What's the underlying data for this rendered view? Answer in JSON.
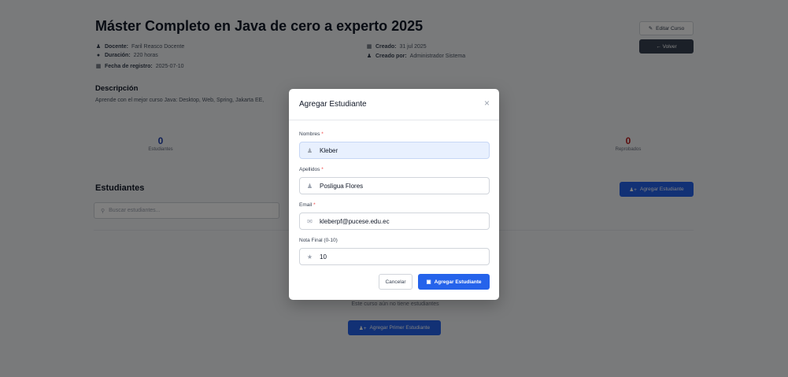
{
  "course": {
    "title": "Máster Completo en Java de cero a experto 2025",
    "docente_label": "Docente:",
    "docente_value": "Faril Reasco Docente",
    "duracion_label": "Duración:",
    "duracion_value": "220 horas",
    "fecha_label": "Fecha de registro:",
    "fecha_value": "2025-07-10",
    "creado_label": "Creado:",
    "creado_value": "31 jul 2025",
    "creado_por_label": "Creado por:",
    "creado_por_value": "Administrador Sistema"
  },
  "actions": {
    "edit_label": "Editar Curso",
    "back_label": "← Volver"
  },
  "description": {
    "heading": "Descripción",
    "text": "Aprende con el mejor curso Java: Desktop, Web, Spring, Jakarta EE,"
  },
  "stats": [
    {
      "value": "0",
      "label": "Estudiantes",
      "color": "#1e40af"
    },
    {
      "value": "0",
      "label": "Reprobados",
      "color": "#b91c1c"
    }
  ],
  "students": {
    "heading": "Estudiantes",
    "search_placeholder": "Buscar estudiantes...",
    "add_label": "Agregar Estudiante",
    "empty_text": "Este curso aún no tiene estudiantes",
    "add_first_label": "Agregar Primer Estudiante"
  },
  "modal": {
    "title": "Agregar Estudiante",
    "close": "×",
    "fields": {
      "nombres": {
        "label": "Nombres",
        "required": "*",
        "value": "Kleber",
        "icon": "user-icon"
      },
      "apellidos": {
        "label": "Apellidos",
        "required": "*",
        "value": "Posligua Flores",
        "icon": "user-icon"
      },
      "email": {
        "label": "Email",
        "required": "*",
        "value": "kleberpf@pucese.edu.ec",
        "icon": "envelope-icon"
      },
      "nota": {
        "label": "Nota Final (0-10)",
        "value": "10",
        "icon": "star-icon"
      }
    },
    "cancel_label": "Cancelar",
    "submit_label": "Agregar Estudiante"
  },
  "colors": {
    "primary": "#2563eb",
    "dark_button": "#374151",
    "overlay": "rgba(0,0,0,0.5)"
  }
}
